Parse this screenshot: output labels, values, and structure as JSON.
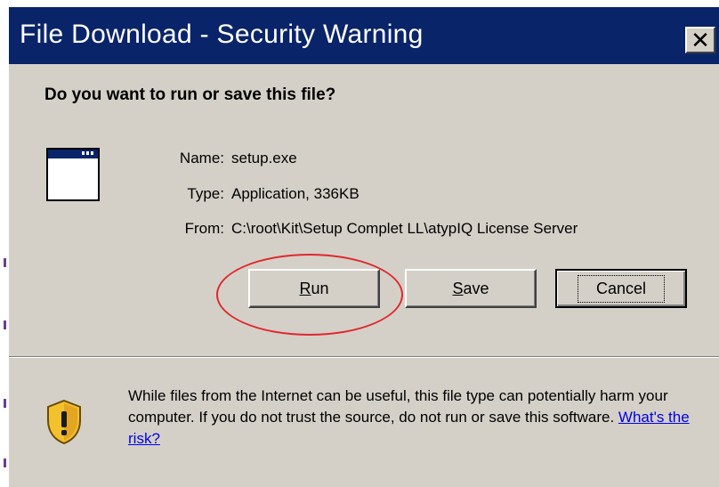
{
  "dialog": {
    "title": "File Download - Security Warning",
    "close_glyph": "✕",
    "question": "Do you want to run or save this file?",
    "icons": {
      "file": "application-window-icon",
      "shield": "security-shield-icon",
      "close": "close-icon"
    },
    "fields": [
      {
        "label": "Name:",
        "value": "setup.exe"
      },
      {
        "label": "Type:",
        "value": "Application, 336KB"
      },
      {
        "label": "From:",
        "value": "C:\\root\\Kit\\Setup Complet LL\\atypIQ License Server"
      }
    ],
    "buttons": {
      "run": {
        "mnemonic": "R",
        "rest": "un"
      },
      "save": {
        "mnemonic": "S",
        "rest": "ave"
      },
      "cancel": {
        "label": "Cancel"
      }
    },
    "warning": {
      "text": "While files from the Internet can be useful, this file type can potentially harm your computer. If you do not trust the source, do not run or save this software. ",
      "link": "What's the risk?"
    },
    "colors": {
      "titlebar": "#0a246a",
      "dialog_bg": "#d4d0c8",
      "annotation_circle": "#e0282d",
      "link": "#0000ee"
    }
  }
}
